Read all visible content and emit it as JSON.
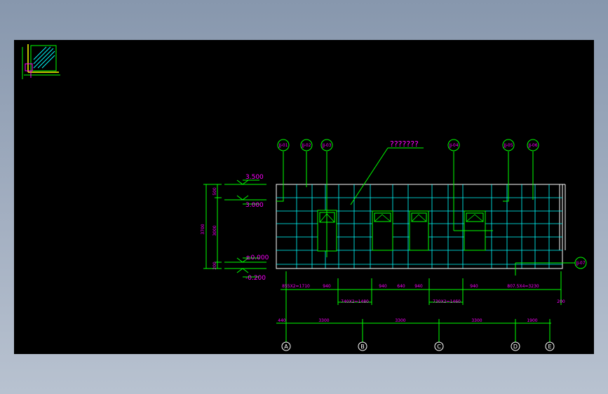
{
  "colors": {
    "background": "#000000",
    "grid": "#00ffff",
    "lines": "#00ff00",
    "dims": "#00ff00",
    "text": "#ff00ff",
    "outline": "#ffffff"
  },
  "title_note": "???????",
  "elevations": {
    "top": "3.500",
    "floor_top": "3.000",
    "ground": "±0.000",
    "bottom": "-0.200"
  },
  "vertical_dims": {
    "total": "3700",
    "upper": "500",
    "middle": "3000",
    "lower": "200"
  },
  "callouts": [
    "JJ-01",
    "JJ-02",
    "JJ-03",
    "JJ-04",
    "JJ-05",
    "JJ-06",
    "JJ-07"
  ],
  "dims_row1": [
    "855X2=1710",
    "940",
    "940",
    "640",
    "940",
    "940",
    "807.5X4=3230"
  ],
  "dims_row2": [
    "740X2=1480",
    "730X2=1460",
    "200"
  ],
  "dims_row3": [
    "440",
    "3300",
    "3300",
    "3300",
    "1900"
  ],
  "axes": [
    "A",
    "B",
    "C",
    "D",
    "E"
  ],
  "icons": [
    "ucs-icon",
    "elevation-marker-icon",
    "axis-bubble-icon",
    "window-icon"
  ]
}
